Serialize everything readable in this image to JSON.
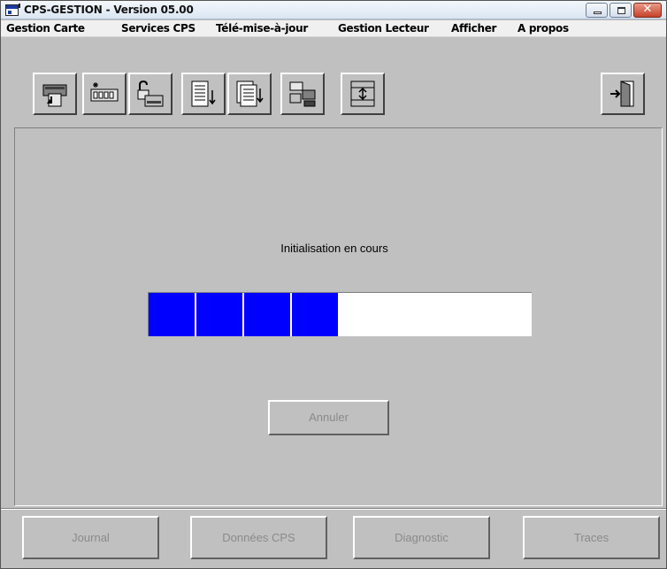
{
  "window": {
    "title": "CPS-GESTION - Version 05.00",
    "controls": {
      "minimize": "minimize-icon",
      "maximize": "maximize-icon",
      "close": "✕"
    }
  },
  "menu": [
    {
      "label": "Gestion Carte"
    },
    {
      "label": "Services CPS"
    },
    {
      "label": "Télé-mise-à-jour"
    },
    {
      "label": "Gestion Lecteur"
    },
    {
      "label": "Afficher"
    },
    {
      "label": "A propos"
    }
  ],
  "toolbar": {
    "buttons": [
      {
        "icon": "card-reader-icon"
      },
      {
        "icon": "pin-code-icon"
      },
      {
        "icon": "unlock-card-icon"
      },
      {
        "icon": "document-list-icon"
      },
      {
        "icon": "document-download-icon"
      },
      {
        "icon": "reader-config-icon"
      },
      {
        "icon": "update-icon"
      },
      {
        "icon": "exit-door-icon"
      }
    ]
  },
  "main": {
    "status": "Initialisation en cours",
    "progress": {
      "segments_filled": 4,
      "segments_total": 8,
      "fraction": 0.5,
      "color": "#0000ff"
    },
    "cancel_label": "Annuler"
  },
  "bottom_buttons": [
    {
      "label": "Journal"
    },
    {
      "label": "Données CPS"
    },
    {
      "label": "Diagnostic"
    },
    {
      "label": "Traces"
    }
  ],
  "colors": {
    "face": "#c0c0c0",
    "progress": "#0000ff",
    "disabled_text": "#8a8a8a"
  }
}
